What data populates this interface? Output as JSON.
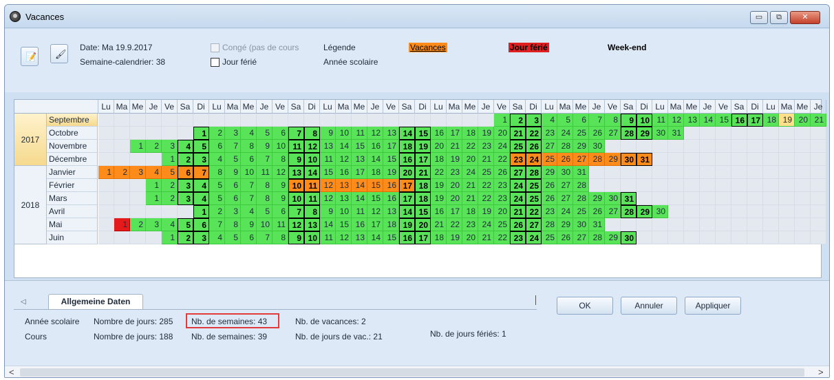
{
  "window": {
    "title": "Vacances",
    "minimize_label": "▭",
    "restore_label": "⧉",
    "close_label": "✕"
  },
  "toolbar": {
    "edit_icon": "notepad-icon",
    "paint_icon": "paintbrush-icon"
  },
  "info": {
    "date": "Date: Ma 19.9.2017",
    "week": "Semaine-calendrier: 38",
    "conge_label": "Congé (pas de cours",
    "jour_ferie_label": "Jour férié",
    "legend_title": "Légende",
    "school_year": "Année scolaire",
    "legend_vacances": "Vacances",
    "legend_jour_ferie": "Jour férié",
    "legend_weekend": "Week-end"
  },
  "colors": {
    "school_day": "#59e359",
    "vacation": "#ff8c1a",
    "holiday": "#e51b1b",
    "selected": "#ffe08a"
  },
  "calendar": {
    "day_headers": [
      "Lu",
      "Ma",
      "Me",
      "Je",
      "Ve",
      "Sa",
      "Di"
    ],
    "years": [
      {
        "label": "2017",
        "span": 4,
        "selected": true
      },
      {
        "label": "2018",
        "span": 6,
        "selected": false
      }
    ],
    "months": [
      {
        "name": "Septembre",
        "offset": 25,
        "days": 30,
        "selected": true
      },
      {
        "name": "Octobre",
        "offset": 6,
        "days": 31
      },
      {
        "name": "Novembre",
        "offset": 2,
        "days": 30
      },
      {
        "name": "Décembre",
        "offset": 4,
        "days": 31
      },
      {
        "name": "Janvier",
        "offset": 0,
        "days": 31
      },
      {
        "name": "Février",
        "offset": 3,
        "days": 28
      },
      {
        "name": "Mars",
        "offset": 3,
        "days": 31
      },
      {
        "name": "Avril",
        "offset": 6,
        "days": 30
      },
      {
        "name": "Mai",
        "offset": 1,
        "days": 31
      },
      {
        "name": "Juin",
        "offset": 4,
        "days": 30
      }
    ],
    "vacations": [
      {
        "month": 3,
        "from": 23,
        "to": 31
      },
      {
        "month": 4,
        "from": 1,
        "to": 7
      },
      {
        "month": 5,
        "from": 10,
        "to": 17
      }
    ],
    "holidays": [
      {
        "month": 8,
        "day": 1
      }
    ],
    "selected_day": {
      "month": 0,
      "day": 19
    }
  },
  "bottom": {
    "tab_label": "Allgemeine Daten",
    "row1": {
      "label": "Année scolaire",
      "days": "Nombre de jours: 285",
      "weeks": "Nb. de semaines: 43",
      "vacations": "Nb. de vacances: 2"
    },
    "row2": {
      "label": "Cours",
      "days": "Nombre de jours: 188",
      "weeks": "Nb. de semaines: 39",
      "vac_days": "Nb. de jours de vac.: 21",
      "holidays": "Nb. de jours fériés: 1"
    },
    "ok_label": "OK",
    "cancel_label": "Annuler",
    "apply_label": "Appliquer",
    "scroll_left": "<",
    "scroll_right": ">"
  }
}
